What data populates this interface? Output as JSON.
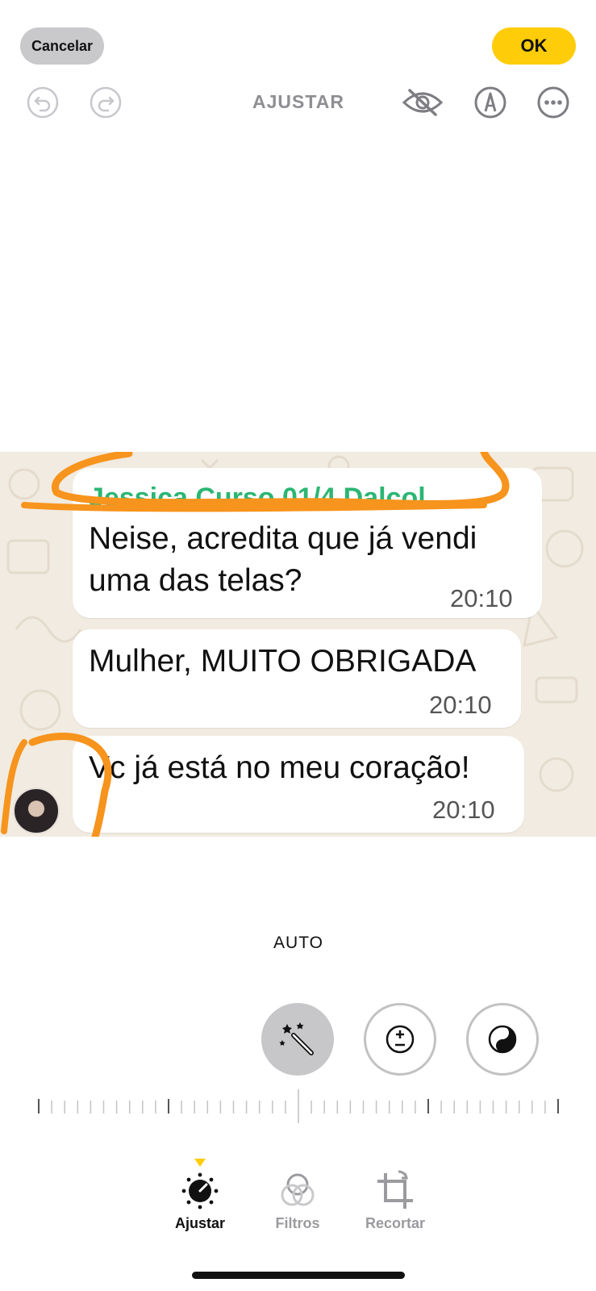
{
  "header": {
    "cancel_label": "Cancelar",
    "ok_label": "OK",
    "title": "AJUSTAR",
    "accent_color": "#ffcc0a",
    "icons": [
      "undo-icon",
      "redo-icon",
      "hide-icon",
      "markup-icon",
      "more-icon"
    ]
  },
  "photo": {
    "messages": [
      {
        "sender": "Jessica Curso 01/4 Dalcol",
        "lines": [
          "Neise, acredita que já vendi",
          "uma das telas?"
        ],
        "time": "20:10"
      },
      {
        "lines": [
          "Mulher, MUITO OBRIGADA"
        ],
        "time": "20:10"
      },
      {
        "lines": [
          "Vc já está no meu coração!"
        ],
        "time": "20:10"
      }
    ],
    "sender_color": "#2bb673",
    "annotation_color": "#f7941d"
  },
  "adjust": {
    "current_tool": "AUTO",
    "tools": [
      "magic-wand-icon",
      "exposure-icon",
      "brilliance-icon"
    ]
  },
  "tabs": [
    {
      "label": "Ajustar",
      "icon": "adjust-dial-icon",
      "active": true
    },
    {
      "label": "Filtros",
      "icon": "filters-icon",
      "active": false
    },
    {
      "label": "Recortar",
      "icon": "crop-icon",
      "active": false
    }
  ]
}
